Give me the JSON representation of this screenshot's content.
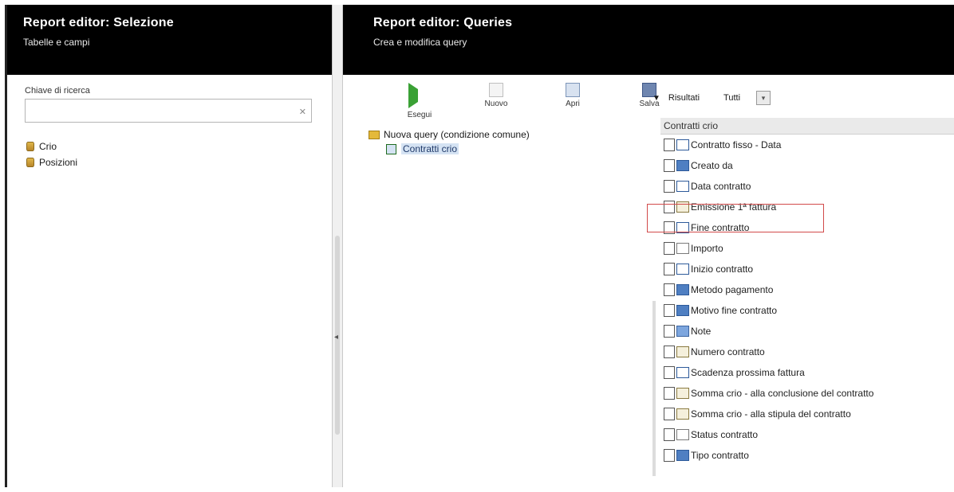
{
  "left_panel": {
    "title": "Report editor: Selezione",
    "subtitle": "Tabelle e campi",
    "search_label": "Chiave di ricerca",
    "search_value": "",
    "search_clear": "✕",
    "tree_items": [
      {
        "label": "Crio",
        "icon": "database-icon"
      },
      {
        "label": "Posizioni",
        "icon": "database-icon"
      }
    ]
  },
  "splitter": {
    "arrow": "◂"
  },
  "right_panel": {
    "title": "Report editor: Queries",
    "subtitle": "Crea e modifica query",
    "toolbar": [
      {
        "label": "Esegui",
        "icon": "play-icon"
      },
      {
        "label": "Nuovo",
        "icon": "new-document-icon"
      },
      {
        "label": "Apri",
        "icon": "open-icon"
      },
      {
        "label": "Salva",
        "icon": "save-icon"
      }
    ],
    "results": {
      "label": "Risultati",
      "value": "Tutti",
      "dropdown": "▾",
      "toggle": "▼"
    },
    "query_tree": {
      "root": "Nuova query (condizione comune)",
      "child": "Contratti crio"
    },
    "fields_title": "Contratti crio",
    "fields": [
      {
        "label": "Contratto fisso - Data",
        "icon": "date-icon"
      },
      {
        "label": "Creato da",
        "icon": "user-icon"
      },
      {
        "label": "Data contratto",
        "icon": "date-icon"
      },
      {
        "label": "Emissione 1ª fattura",
        "icon": "text-icon"
      },
      {
        "label": "Fine contratto",
        "icon": "date-icon"
      },
      {
        "label": "Importo",
        "icon": "number-icon"
      },
      {
        "label": "Inizio contratto",
        "icon": "date-icon"
      },
      {
        "label": "Metodo pagamento",
        "icon": "user-icon"
      },
      {
        "label": "Motivo fine contratto",
        "icon": "user-icon"
      },
      {
        "label": "Note",
        "icon": "note-icon"
      },
      {
        "label": "Numero contratto",
        "icon": "edit-icon"
      },
      {
        "label": "Scadenza prossima fattura",
        "icon": "date-icon"
      },
      {
        "label": "Somma crio - alla conclusione del contratto",
        "icon": "edit-icon"
      },
      {
        "label": "Somma crio - alla stipula del contratto",
        "icon": "edit-icon"
      },
      {
        "label": "Status contratto",
        "icon": "number-icon"
      },
      {
        "label": "Tipo contratto",
        "icon": "user-icon"
      }
    ]
  },
  "colors": {
    "header_bg": "#000000",
    "highlight": "#d24a4a",
    "tree_icon": "#3e9a3e"
  }
}
